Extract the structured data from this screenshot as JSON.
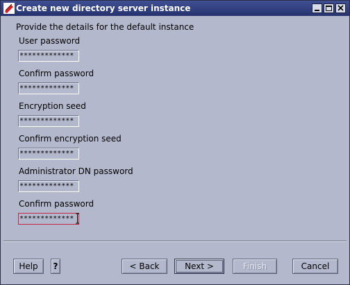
{
  "window": {
    "title": "Create new directory server instance"
  },
  "instruction": "Provide the details for the default instance",
  "fields": {
    "user_password": {
      "label": "User password",
      "value": "*************"
    },
    "confirm_password": {
      "label": "Confirm password",
      "value": "*************"
    },
    "encryption_seed": {
      "label": "Encryption seed",
      "value": "*************"
    },
    "confirm_encryption_seed": {
      "label": "Confirm encryption seed",
      "value": "*************"
    },
    "admin_dn_password": {
      "label": "Administrator DN password",
      "value": "*************"
    },
    "confirm_admin_password": {
      "label": "Confirm password",
      "value": "*************"
    }
  },
  "buttons": {
    "help": "Help",
    "question": "?",
    "back": "< Back",
    "next": "Next >",
    "finish": "Finish",
    "cancel": "Cancel"
  },
  "colors": {
    "window_background": "#b4b8cc",
    "titlebar": "#27336f",
    "focus_border": "#c0284a"
  },
  "icons": {
    "title": "app-logo-icon",
    "minimize": "minimize-icon",
    "maximize": "maximize-icon",
    "close": "close-icon",
    "caret": "text-cursor-icon"
  }
}
